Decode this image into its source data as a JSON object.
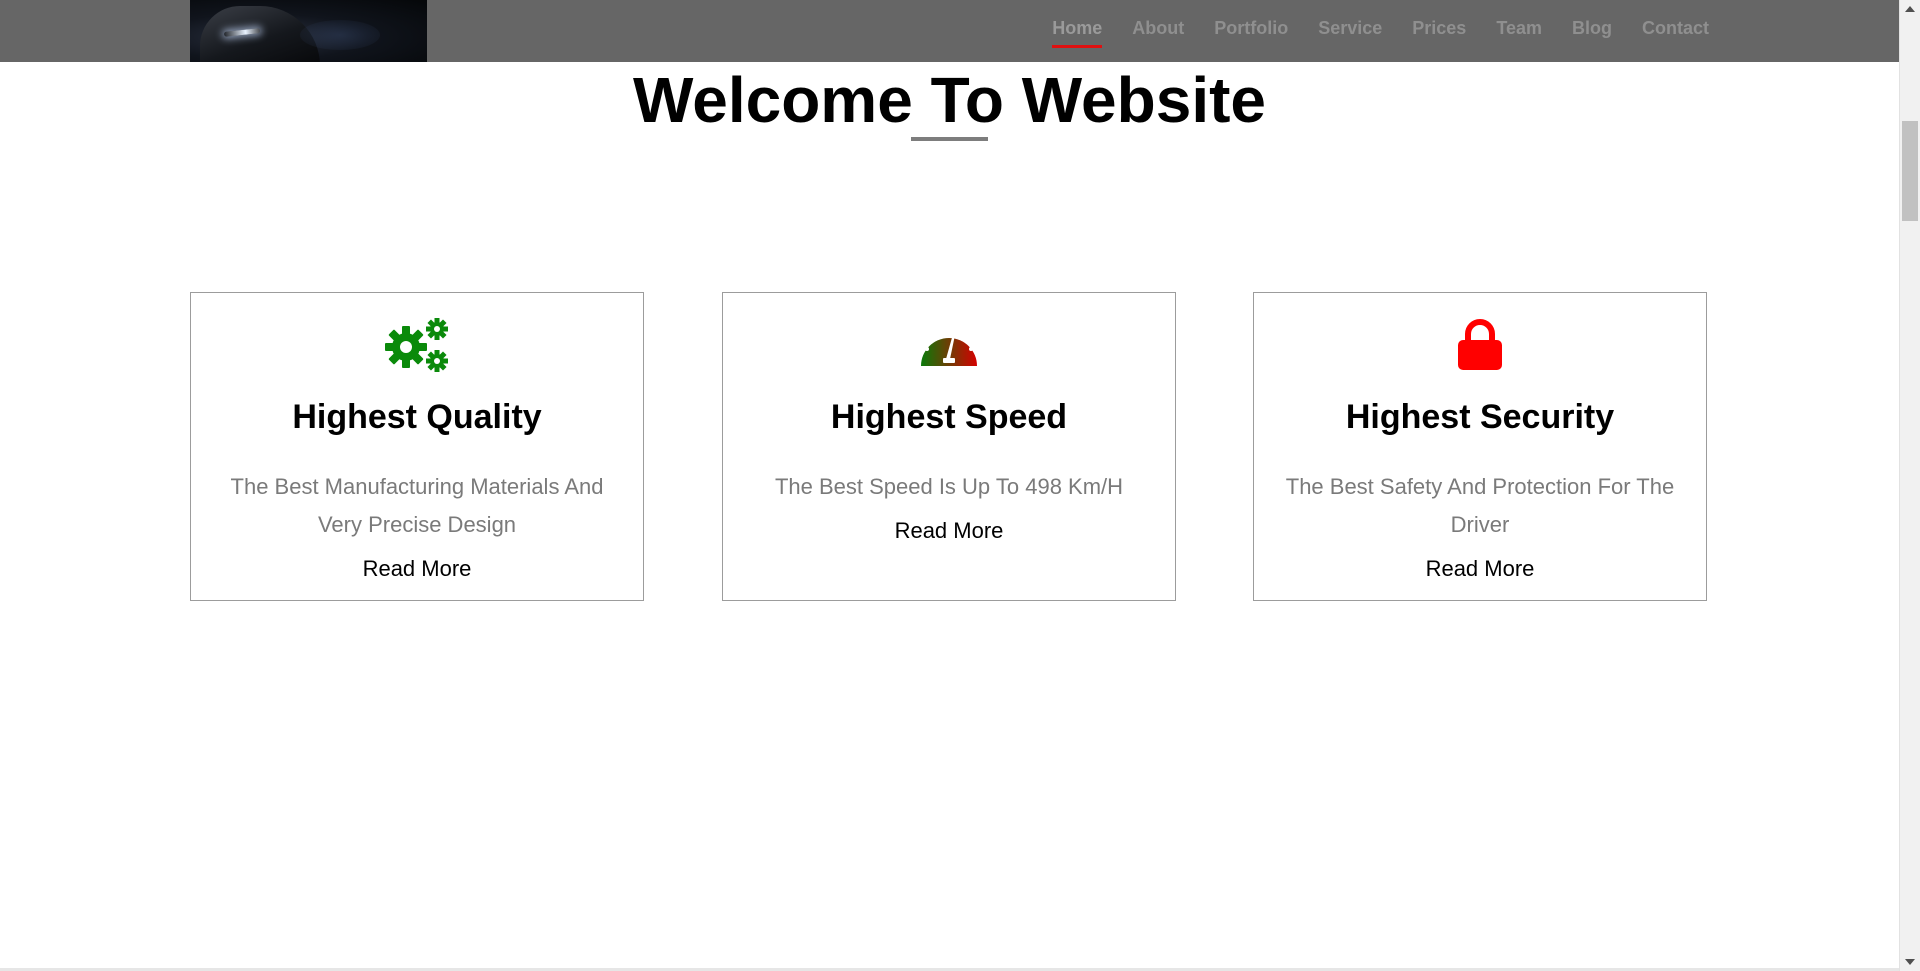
{
  "nav": {
    "items": [
      {
        "label": "Home",
        "active": true
      },
      {
        "label": "About",
        "active": false
      },
      {
        "label": "Portfolio",
        "active": false
      },
      {
        "label": "Service",
        "active": false
      },
      {
        "label": "Prices",
        "active": false
      },
      {
        "label": "Team",
        "active": false
      },
      {
        "label": "Blog",
        "active": false
      },
      {
        "label": "Contact",
        "active": false
      }
    ]
  },
  "welcome": {
    "title": "Welcome To Website"
  },
  "cards": [
    {
      "icon": "gears-icon",
      "title": "Highest Quality",
      "description": "The Best Manufacturing Materials And Very Precise Design",
      "read_more": "Read More"
    },
    {
      "icon": "speedometer-icon",
      "title": "Highest Speed",
      "description": "The Best Speed Is Up To 498 Km/H",
      "read_more": "Read More"
    },
    {
      "icon": "lock-icon",
      "title": "Highest Security",
      "description": "The Best Safety And Protection For The Driver",
      "read_more": "Read More"
    }
  ],
  "colors": {
    "header_bg": "#666666",
    "nav_text": "#8f8f8f",
    "active_underline": "#e01010",
    "gears_icon": "#0a8a0a",
    "lock_icon": "#ff0000",
    "speedometer_gradient": [
      "#0a7a0a",
      "#d40000"
    ],
    "description_text": "#7a7a7a"
  }
}
